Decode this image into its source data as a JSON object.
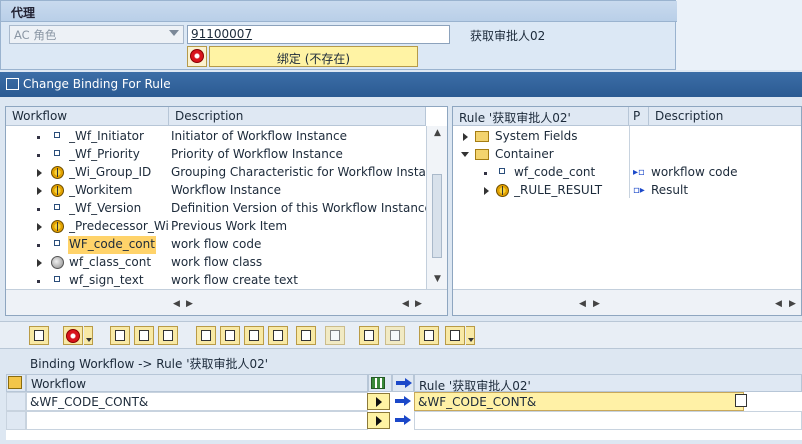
{
  "agent": {
    "title": "代理",
    "type_select": "AC 角色",
    "agent_id": "91100007",
    "agent_desc": "获取审批人02",
    "bind_button": "绑定 (不存在)"
  },
  "dialog": {
    "title": "Change Binding For Rule"
  },
  "workflow_tree": {
    "headers": [
      "Workflow",
      "Description"
    ],
    "rows": [
      {
        "name": "_Wf_Initiator",
        "desc": "Initiator of Workflow Instance",
        "icon": "element-icon"
      },
      {
        "name": "_Wf_Priority",
        "desc": "Priority of Workflow Instance",
        "icon": "element-icon"
      },
      {
        "name": "_Wi_Group_ID",
        "desc": "Grouping Characteristic for Workflow Instances",
        "icon": "object-icon"
      },
      {
        "name": "_Workitem",
        "desc": "Workflow Instance",
        "icon": "object-icon"
      },
      {
        "name": "_Wf_Version",
        "desc": "Definition Version of this Workflow Instance",
        "icon": "element-icon"
      },
      {
        "name": "_Predecessor_Wi",
        "desc": "Previous Work Item",
        "icon": "object-icon"
      },
      {
        "name": "WF_code_cont",
        "desc": "work flow code",
        "icon": "element-icon",
        "selected": true
      },
      {
        "name": "wf_class_cont",
        "desc": "work flow class",
        "icon": "class-icon"
      },
      {
        "name": "wf_sign_text",
        "desc": "work flow create text",
        "icon": "element-icon"
      }
    ]
  },
  "rule_tree": {
    "headers": [
      "Rule '获取审批人02'",
      "P",
      "Description"
    ],
    "rows": [
      {
        "name": "System Fields",
        "desc": ""
      },
      {
        "name": "Container",
        "desc": ""
      },
      {
        "name": "wf_code_cont",
        "desc": "workflow code"
      },
      {
        "name": "_RULE_RESULT",
        "desc": "Result"
      }
    ]
  },
  "binding": {
    "label": "Binding Workflow  -> Rule '获取审批人02'",
    "col_workflow": "Workflow",
    "col_rule": "Rule '获取审批人02'",
    "rows": [
      {
        "workflow": "&WF_CODE_CONT&",
        "rule": "&WF_CODE_CONT&"
      },
      {
        "workflow": "",
        "rule": ""
      }
    ]
  }
}
